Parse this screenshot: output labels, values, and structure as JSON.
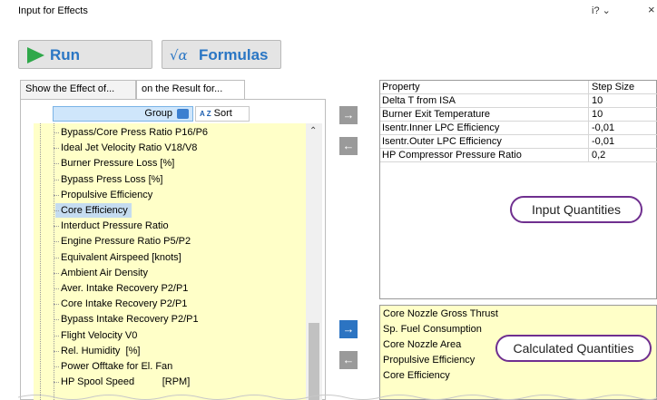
{
  "window": {
    "title": "Input for Effects",
    "help_label": "i?",
    "close_label": "×"
  },
  "toolbar": {
    "run_label": "Run",
    "formulas_label": "Formulas",
    "formulas_icon_text": "√α"
  },
  "tabs": {
    "effect_of": "Show the Effect of...",
    "result_for": "on the Result for..."
  },
  "list_header": {
    "group_label": "Group",
    "sort_label": "Sort",
    "sort_icon_text": "A Z"
  },
  "tree": {
    "items": [
      {
        "label": "Bypass/Core Press Ratio P16/P6"
      },
      {
        "label": "Ideal Jet Velocity Ratio V18/V8"
      },
      {
        "label": "Burner Pressure Loss [%]"
      },
      {
        "label": "Bypass Press Loss [%]"
      },
      {
        "label": "Propulsive Efficiency"
      },
      {
        "label": "Core Efficiency",
        "selected": true
      },
      {
        "label": "Interduct Pressure Ratio"
      },
      {
        "label": "Engine Pressure Ratio P5/P2"
      },
      {
        "label": "Equivalent Airspeed [knots]"
      },
      {
        "label": "Ambient Air Density"
      },
      {
        "label": "Aver. Intake Recovery P2/P1"
      },
      {
        "label": "Core Intake Recovery P2/P1"
      },
      {
        "label": "Bypass Intake Recovery P2/P1"
      },
      {
        "label": "Flight Velocity V0"
      },
      {
        "label": "Rel. Humidity  [%]"
      },
      {
        "label": "Power Offtake for El. Fan"
      },
      {
        "label": "HP Spool Speed          [RPM]"
      }
    ]
  },
  "arrows": {
    "right": "→",
    "left": "←"
  },
  "input_grid": {
    "headers": {
      "property": "Property",
      "step": "Step Size"
    },
    "rows": [
      {
        "property": "Delta T from ISA",
        "step": "10"
      },
      {
        "property": "Burner Exit Temperature",
        "step": "10"
      },
      {
        "property": "Isentr.Inner LPC Efficiency",
        "step": "-0,01"
      },
      {
        "property": "Isentr.Outer LPC Efficiency",
        "step": "-0,01"
      },
      {
        "property": "HP Compressor Pressure Ratio",
        "step": "0,2"
      }
    ]
  },
  "calculated": {
    "items": [
      "Core Nozzle Gross Thrust",
      "Sp. Fuel Consumption",
      "Core Nozzle Area",
      "Propulsive Efficiency",
      "Core Efficiency"
    ]
  },
  "callouts": {
    "input": "Input Quantities",
    "calculated": "Calculated Quantities"
  },
  "colors": {
    "list_background": "#ffffc8",
    "selected_item": "#c5dcf0",
    "accent_blue": "#2c74c2",
    "run_green": "#2fa84a",
    "callout_border": "#6f2f8f"
  }
}
